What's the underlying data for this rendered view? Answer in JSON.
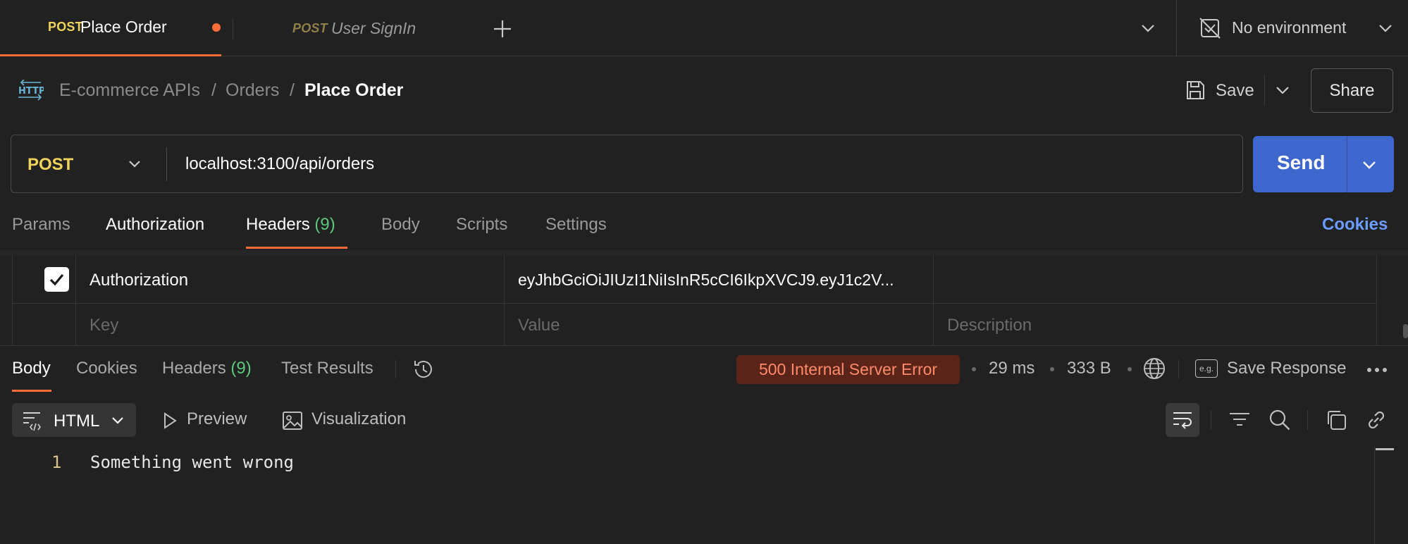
{
  "tabs": [
    {
      "method": "POST",
      "name": "Place Order",
      "unsaved": true,
      "active": true
    },
    {
      "method": "POST",
      "name": "User SignIn",
      "unsaved": false,
      "active": false
    }
  ],
  "environment": {
    "label": "No environment"
  },
  "breadcrumb": {
    "collection": "E-commerce APIs",
    "folder": "Orders",
    "current": "Place Order",
    "sep": "/"
  },
  "actions": {
    "save_label": "Save",
    "share_label": "Share"
  },
  "request": {
    "method": "POST",
    "url": "localhost:3100/api/orders",
    "send_label": "Send"
  },
  "request_tabs": {
    "params": "Params",
    "authorization": "Authorization",
    "headers": "Headers",
    "headers_count": "(9)",
    "body": "Body",
    "scripts": "Scripts",
    "settings": "Settings",
    "cookies": "Cookies"
  },
  "headers_table": {
    "rows": [
      {
        "enabled": true,
        "key": "Authorization",
        "value": "eyJhbGciOiJIUzI1NiIsInR5cCI6IkpXVCJ9.eyJ1c2V...",
        "description": ""
      }
    ],
    "placeholders": {
      "key": "Key",
      "value": "Value",
      "description": "Description"
    }
  },
  "response_tabs": {
    "body": "Body",
    "cookies": "Cookies",
    "headers": "Headers",
    "headers_count": "(9)",
    "tests": "Test Results"
  },
  "response_meta": {
    "status": "500 Internal Server Error",
    "time": "29 ms",
    "size": "333 B",
    "save_response": "Save Response",
    "eg_label": "e.g."
  },
  "response_tools": {
    "format": "HTML",
    "preview": "Preview",
    "visualization": "Visualization"
  },
  "response_body": {
    "lines": [
      {
        "num": "1",
        "text": "Something went wrong"
      }
    ]
  },
  "colors": {
    "accent": "#ff6c37",
    "post": "#f0d35b",
    "send": "#3d67cc",
    "cookies": "#6b9cff",
    "count": "#5cc97b",
    "error_bg": "#5a2418",
    "error_text": "#ff8a6b"
  }
}
